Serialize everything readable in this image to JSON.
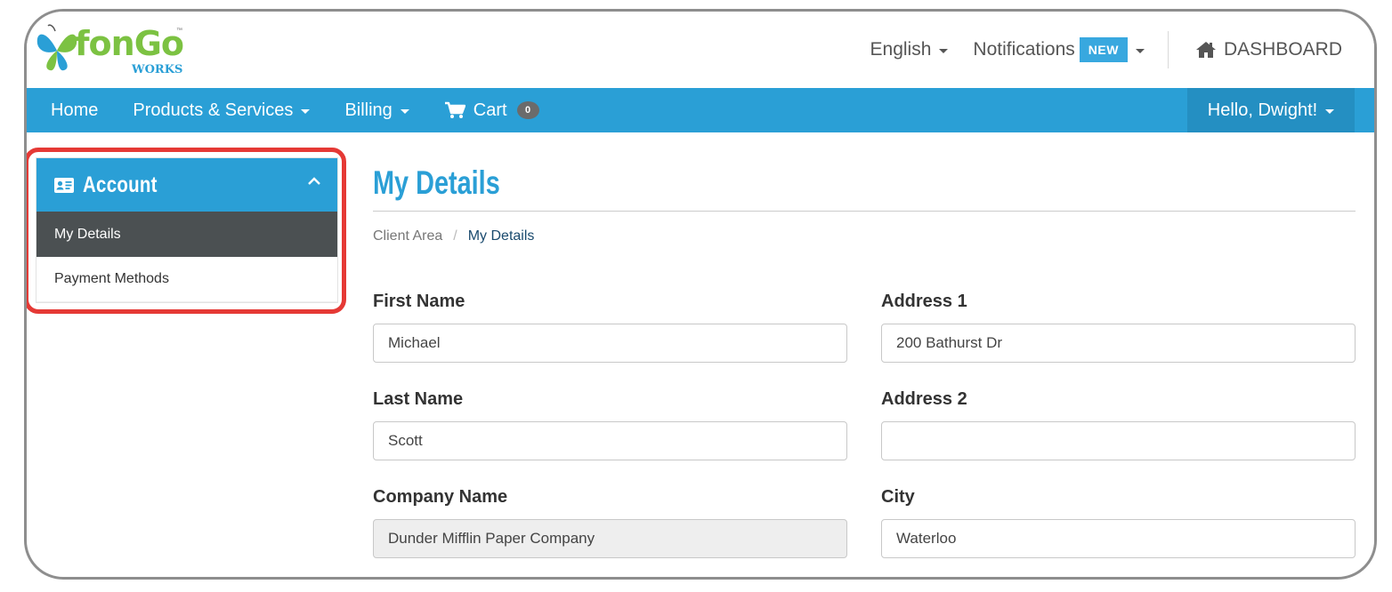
{
  "brand": {
    "logo_text": "fonGo",
    "logo_sub": "WORKS",
    "logo_tm": "™"
  },
  "topbar": {
    "language": "English",
    "notifications": "Notifications",
    "notifications_badge": "NEW",
    "dashboard": "DASHBOARD"
  },
  "nav": {
    "items": [
      {
        "label": "Home"
      },
      {
        "label": "Products & Services"
      },
      {
        "label": "Billing"
      },
      {
        "label": "Cart"
      }
    ],
    "cart_count": "0",
    "user_greeting": "Hello, Dwight!"
  },
  "sidebar": {
    "title": "Account",
    "items": [
      {
        "label": "My Details",
        "active": true
      },
      {
        "label": "Payment Methods",
        "active": false
      }
    ]
  },
  "main": {
    "title": "My Details",
    "breadcrumb": {
      "root": "Client Area",
      "separator": "/",
      "current": "My Details"
    },
    "fields": {
      "first_name": {
        "label": "First Name",
        "value": "Michael"
      },
      "last_name": {
        "label": "Last Name",
        "value": "Scott"
      },
      "company_name": {
        "label": "Company Name",
        "value": "Dunder Mifflin Paper Company"
      },
      "address1": {
        "label": "Address 1",
        "value": "200 Bathurst Dr"
      },
      "address2": {
        "label": "Address 2",
        "value": ""
      },
      "city": {
        "label": "City",
        "value": "Waterloo"
      }
    }
  },
  "colors": {
    "primary": "#2a9fd6",
    "active_item": "#4b5052",
    "highlight": "#e53935",
    "logo_green": "#7cc242"
  },
  "icons": {
    "dashboard": "home-icon",
    "cart": "cart-icon",
    "account": "id-card-icon",
    "collapse": "chevron-up-icon"
  }
}
